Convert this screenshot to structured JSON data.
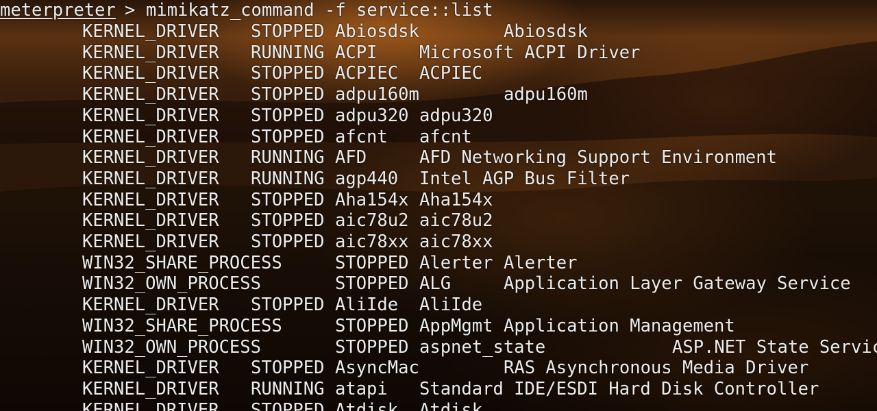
{
  "prompt": {
    "label": "meterpreter",
    "separator": ">",
    "command": "mimikatz_command -f service::list"
  },
  "rows": [
    {
      "type": "KERNEL_DRIVER",
      "state": "STOPPED",
      "name": "Abiosdsk",
      "display": "Abiosdsk"
    },
    {
      "type": "KERNEL_DRIVER",
      "state": "RUNNING",
      "name": "ACPI",
      "display": "Microsoft ACPI Driver"
    },
    {
      "type": "KERNEL_DRIVER",
      "state": "STOPPED",
      "name": "ACPIEC",
      "display": "ACPIEC"
    },
    {
      "type": "KERNEL_DRIVER",
      "state": "STOPPED",
      "name": "adpu160m",
      "display": "adpu160m"
    },
    {
      "type": "KERNEL_DRIVER",
      "state": "STOPPED",
      "name": "adpu320",
      "display": "adpu320"
    },
    {
      "type": "KERNEL_DRIVER",
      "state": "STOPPED",
      "name": "afcnt",
      "display": "afcnt"
    },
    {
      "type": "KERNEL_DRIVER",
      "state": "RUNNING",
      "name": "AFD",
      "display": "AFD Networking Support Environment"
    },
    {
      "type": "KERNEL_DRIVER",
      "state": "RUNNING",
      "name": "agp440",
      "display": "Intel AGP Bus Filter"
    },
    {
      "type": "KERNEL_DRIVER",
      "state": "STOPPED",
      "name": "Aha154x",
      "display": "Aha154x"
    },
    {
      "type": "KERNEL_DRIVER",
      "state": "STOPPED",
      "name": "aic78u2",
      "display": "aic78u2"
    },
    {
      "type": "KERNEL_DRIVER",
      "state": "STOPPED",
      "name": "aic78xx",
      "display": "aic78xx"
    },
    {
      "type": "WIN32_SHARE_PROCESS",
      "state": "STOPPED",
      "name": "Alerter",
      "display": "Alerter"
    },
    {
      "type": "WIN32_OWN_PROCESS",
      "state": "STOPPED",
      "name": "ALG",
      "display": "Application Layer Gateway Service"
    },
    {
      "type": "KERNEL_DRIVER",
      "state": "STOPPED",
      "name": "AliIde",
      "display": "AliIde"
    },
    {
      "type": "WIN32_SHARE_PROCESS",
      "state": "STOPPED",
      "name": "AppMgmt",
      "display": "Application Management"
    },
    {
      "type": "WIN32_OWN_PROCESS",
      "state": "STOPPED",
      "name": "aspnet_state",
      "display": "ASP.NET State Service"
    },
    {
      "type": "KERNEL_DRIVER",
      "state": "STOPPED",
      "name": "AsyncMac",
      "display": "RAS Asynchronous Media Driver"
    },
    {
      "type": "KERNEL_DRIVER",
      "state": "RUNNING",
      "name": "atapi",
      "display": "Standard IDE/ESDI Hard Disk Controller"
    },
    {
      "type": "KERNEL_DRIVER",
      "state": "STOPPED",
      "name": "Atdisk",
      "display": "Atdisk"
    }
  ]
}
